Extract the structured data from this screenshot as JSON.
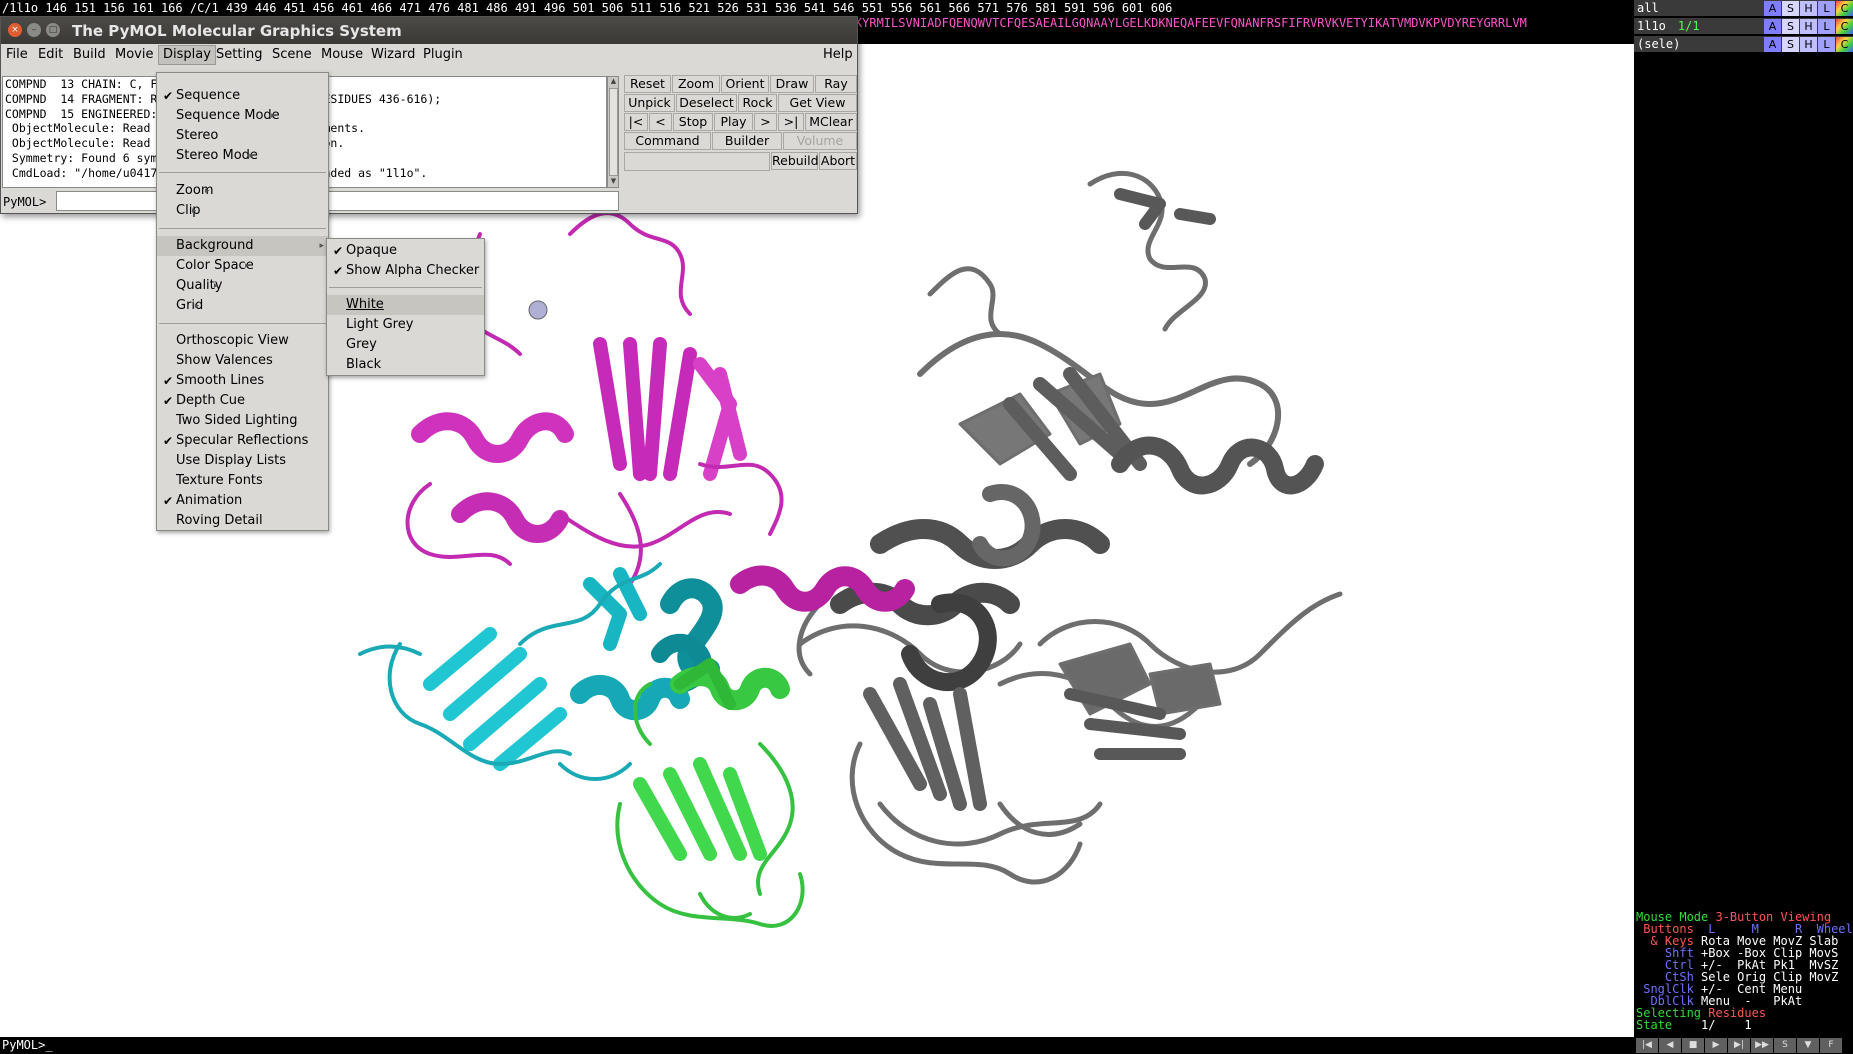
{
  "seqbar": {
    "row1": "/1l1o  146  151  156  161  166   /C/1  439     446  451  456  461  466  471  476  481  486  491  496  501  506  511  516  521  526  531  536  541  546  551  556  561  566  571  576  581  591  596  601  606",
    "row2": "EPNFKYRMILSVNIADFQENQWVTCFQESAEAILGQNAAYLGELKDKNEQAFEEVFQNANFRSFIFRVRVKVETYIKATVMDVKPVDYREYGRRLVM"
  },
  "window": {
    "title": "The PyMOL Molecular Graphics System",
    "close_glyph": "×",
    "min_glyph": "–",
    "max_glyph": "□"
  },
  "menubar": {
    "file": "File",
    "edit": "Edit",
    "build": "Build",
    "movie": "Movie",
    "display": "Display",
    "setting": "Setting",
    "scene": "Scene",
    "mouse": "Mouse",
    "wizard": "Wizard",
    "plugin": "Plugin",
    "help": "Help"
  },
  "output_lines": [
    "COMPND  13 CHAIN: C, F;                     ",
    "COMPND  14 FRAGMENT: R                      (RESIDUES 436-616);",
    "COMPND  15 ENGINEERED:                      ",
    " ObjectMolecule: Read                       gnments.",
    " ObjectMolecule: Read                       tion.",
    " Symmetry: Found 6 sym",
    " CmdLoad: \"/home/u0417                      loaded as \"1l1o\"."
  ],
  "command_prompt": "PyMOL>",
  "buttons": {
    "reset": "Reset",
    "zoom": "Zoom",
    "orient": "Orient",
    "draw": "Draw",
    "ray": "Ray",
    "unpick": "Unpick",
    "deselect": "Deselect",
    "rock": "Rock",
    "getview": "Get View",
    "rewind": "|<",
    "back": "<",
    "stop": "Stop",
    "play": "Play",
    "fwd": ">",
    "end": ">|",
    "mclear": "MClear",
    "command": "Command",
    "builder": "Builder",
    "volume": "Volume",
    "rebuild": "Rebuild",
    "abort": "Abort"
  },
  "display_menu": {
    "sequence": "Sequence",
    "sequence_mode": "Sequence Mode",
    "stereo": "Stereo",
    "stereo_mode": "Stereo Mode",
    "zoom": "Zoom",
    "clip": "Clip",
    "background": "Background",
    "color_space": "Color Space",
    "quality": "Quality",
    "grid": "Grid",
    "orthoscopic": "Orthoscopic View",
    "show_valences": "Show Valences",
    "smooth_lines": "Smooth Lines",
    "depth_cue": "Depth Cue",
    "two_sided": "Two Sided Lighting",
    "specular": "Specular Reflections",
    "display_lists": "Use Display Lists",
    "texture_fonts": "Texture Fonts",
    "animation": "Animation",
    "roving": "Roving Detail"
  },
  "background_menu": {
    "opaque": "Opaque",
    "alpha_checker": "Show Alpha Checker",
    "white": "White",
    "light_grey": "Light Grey",
    "grey": "Grey",
    "black": "Black"
  },
  "check_glyph": "✔",
  "sub_glyph": "▸",
  "objects": [
    {
      "name": "all",
      "state": ""
    },
    {
      "name": "1l1o",
      "state": "1/1"
    },
    {
      "name": "(sele)",
      "state": ""
    }
  ],
  "obj_buttons": {
    "a": "A",
    "s": "S",
    "h": "H",
    "l": "L",
    "c": "C"
  },
  "mouse_help": {
    "l1a": "Mouse Mode ",
    "l1b": "3-Button Viewing",
    "l2a": " Buttons",
    "l2b": "  L     M     R  Wheel",
    "l3a": "  & Keys",
    "l3b": " Rota Move MovZ Slab",
    "l4a": "    Shft",
    "l4b": " +Box -Box Clip MovS",
    "l5a": "    Ctrl",
    "l5b": " +/-  PkAt Pk1  MvSZ",
    "l6a": "    CtSh",
    "l6b": " Sele Orig Clip MovZ",
    "l7a": " SnglClk",
    "l7b": " +/-  Cent Menu",
    "l8a": "  DblClk",
    "l8b": " Menu  -   PkAt",
    "l9a": "Selecting ",
    "l9b": "Residues",
    "l10a": "State ",
    "l10b": "   1/    1"
  },
  "play_controls": [
    "|◀",
    "◀",
    "■",
    "▶",
    "▶|",
    "▶▶",
    "S",
    "▼",
    "F"
  ],
  "bottom_prompt": "PyMOL>_",
  "colors": {
    "chain_magenta": "#d63bc4",
    "chain_cyan": "#1fc4cf",
    "chain_green": "#3fd24a",
    "chain_grey": "#6e6e6e",
    "seq_text": "#ff55cc",
    "menu_bg": "#dad9d5"
  }
}
